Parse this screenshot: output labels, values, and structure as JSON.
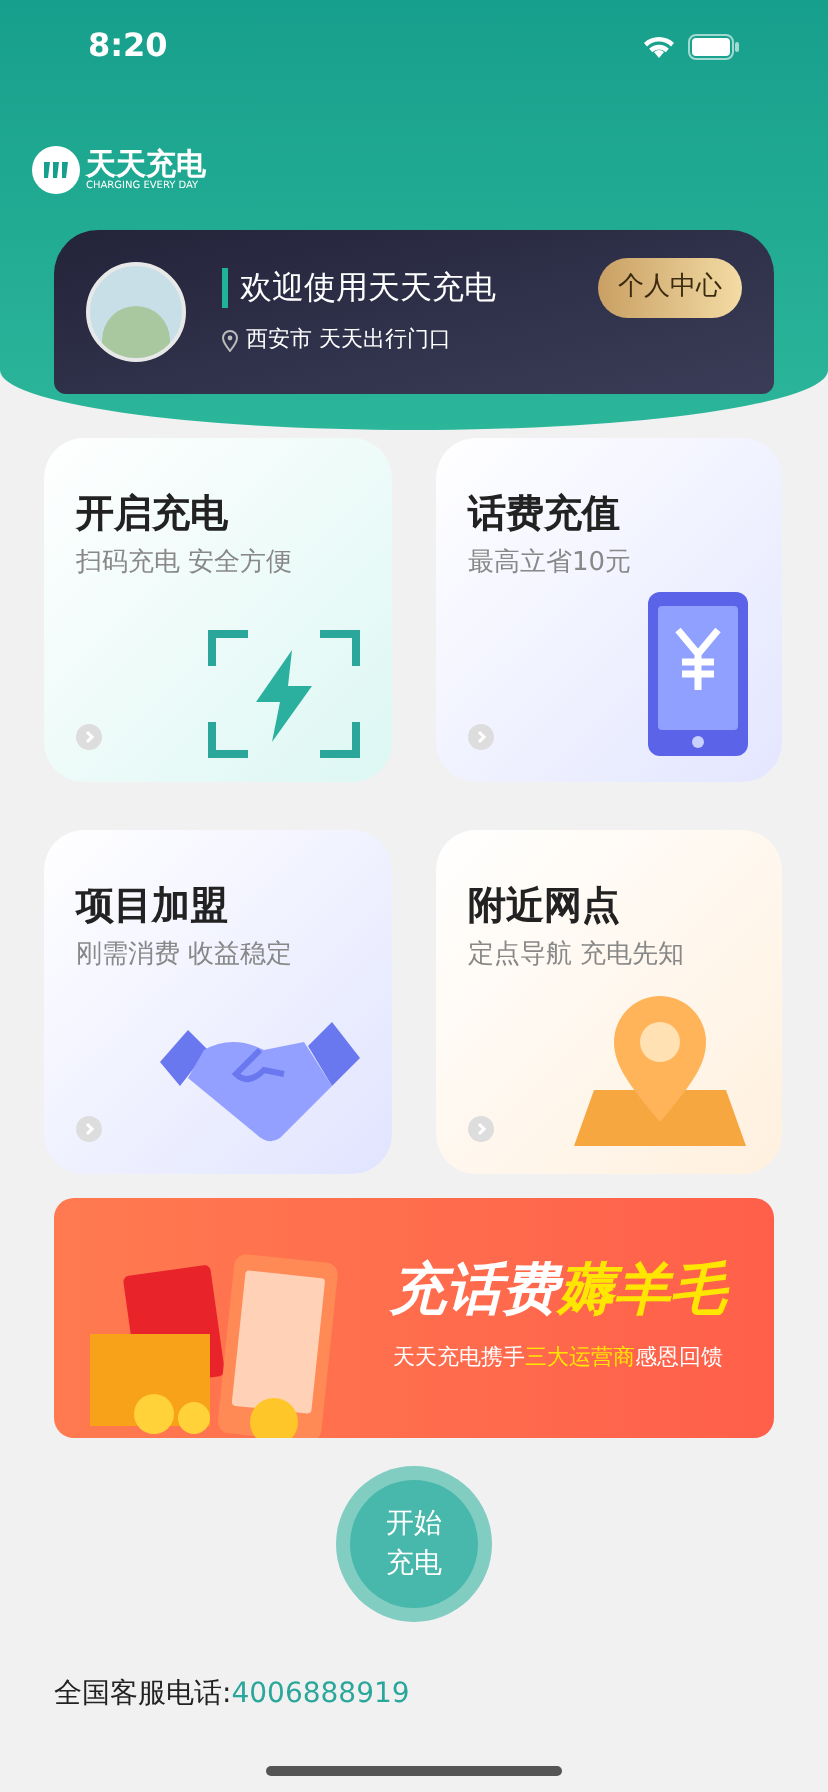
{
  "status_bar": {
    "time": "8:20"
  },
  "logo": {
    "name": "天天充电",
    "slogan": "CHARGING EVERY DAY"
  },
  "user_card": {
    "greeting": "欢迎使用天天充电",
    "location": "西安市 天天出行门口",
    "button": "个人中心"
  },
  "services": [
    {
      "kind": "charge",
      "title": "开启充电",
      "subtitle": "扫码充电 安全方便"
    },
    {
      "kind": "topup",
      "title": "话费充值",
      "subtitle": "最高立省10元"
    },
    {
      "kind": "franchise",
      "title": "项目加盟",
      "subtitle": "刚需消费 收益稳定"
    },
    {
      "kind": "nearby",
      "title": "附近网点",
      "subtitle": "定点导航 充电先知"
    }
  ],
  "banner": {
    "title": [
      {
        "text": "充话费",
        "highlight": false
      },
      {
        "text": "薅羊毛",
        "highlight": true
      }
    ],
    "subtitle": [
      {
        "text": "天天充电携手",
        "highlight": false
      },
      {
        "text": "三大运营商",
        "highlight": true
      },
      {
        "text": "感恩回馈",
        "highlight": false
      }
    ]
  },
  "start_button": {
    "line_1": "开始",
    "line_2": "充电"
  },
  "hotline": {
    "label": "全国客服电话:",
    "number": "4006888919"
  }
}
